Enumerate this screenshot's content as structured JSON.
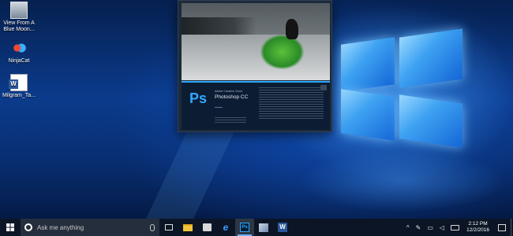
{
  "desktop": {
    "icons": [
      {
        "label": "View From A Blue Moon...",
        "icon": "image-thumbnail-icon"
      },
      {
        "label": "NinjaCat",
        "icon": "ninjacat-icon"
      },
      {
        "label": "Milgram_Ta...",
        "icon": "word-document-icon"
      }
    ]
  },
  "splash": {
    "app_logo": "Ps",
    "suite_label": "Adobe Creative Cloud",
    "app_name": "Photoshop CC"
  },
  "taskbar": {
    "search_placeholder": "Ask me anything",
    "apps": [
      {
        "name": "task-view",
        "icon": "task-view-icon"
      },
      {
        "name": "file-explorer",
        "icon": "folder-icon"
      },
      {
        "name": "store",
        "icon": "store-bag-icon"
      },
      {
        "name": "edge",
        "icon": "edge-icon",
        "glyph": "e"
      },
      {
        "name": "photoshop",
        "icon": "photoshop-icon",
        "glyph": "Ps",
        "active": true
      },
      {
        "name": "app",
        "icon": "app-icon"
      },
      {
        "name": "word",
        "icon": "word-icon",
        "glyph": "W"
      }
    ],
    "tray": {
      "chevron": "^",
      "time": "2:12 PM",
      "date": "12/2/2016"
    }
  },
  "colors": {
    "ps_blue": "#31a8ff",
    "taskbar_bg": "#0b1525",
    "word_blue": "#2b579a"
  }
}
